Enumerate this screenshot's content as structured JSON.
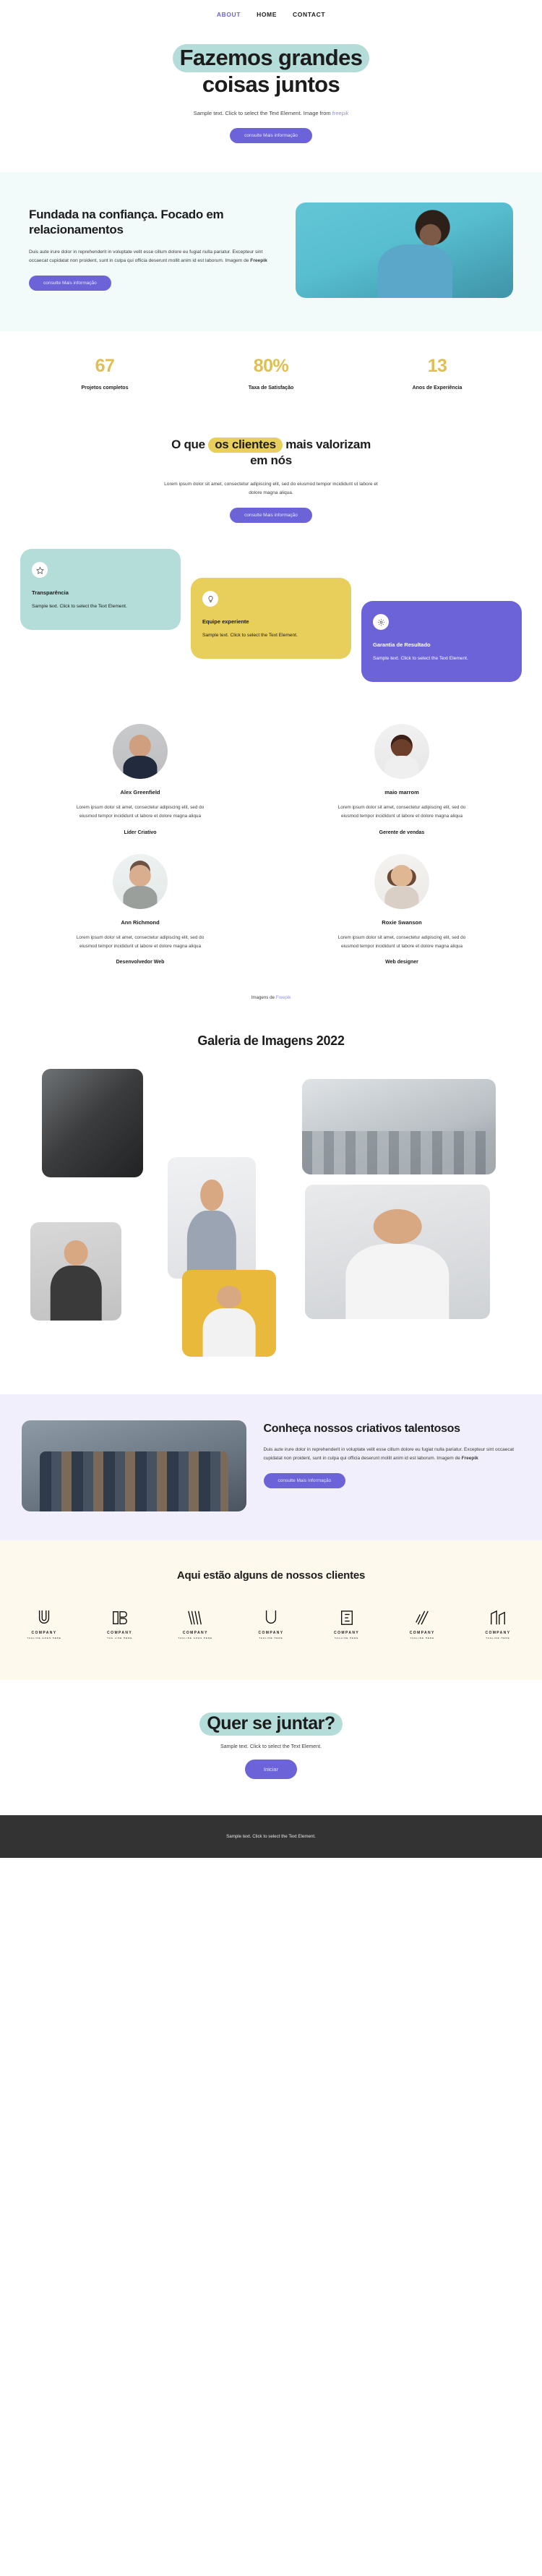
{
  "nav": {
    "items": [
      {
        "label": "ABOUT",
        "active": true
      },
      {
        "label": "HOME",
        "active": false
      },
      {
        "label": "CONTACT",
        "active": false
      }
    ]
  },
  "hero": {
    "title_line1": "Fazemos grandes",
    "title_line2": "coisas juntos",
    "subtitle_prefix": "Sample text. Click to select the Text Element. Image from ",
    "subtitle_link": "freepik",
    "cta": "consulte Mais informação"
  },
  "about": {
    "heading": "Fundada na confiança. Focado em relacionamentos",
    "body": "Duis aute irure dolor in reprehenderit in voluptate velit esse cillum dolore eu fugiat nulla pariatur. Excepteur sint occaecat cupidatat non proident, sunt in culpa qui officia deserunt mollit anim id est laborum. Imagem de ",
    "body_bold": "Freepik",
    "cta": "consulte Mais informação"
  },
  "stats": {
    "accent_color": "#ddbf52",
    "items": [
      {
        "number": "67",
        "label": "Projetos completos"
      },
      {
        "number": "80%",
        "label": "Taxa de Satisfação"
      },
      {
        "number": "13",
        "label": "Anos de Experiência"
      }
    ]
  },
  "values": {
    "heading_p1": "O que ",
    "heading_hl": "os clientes",
    "heading_p2": " mais valorizam em nós",
    "body": "Lorem ipsum dolor sit amet, consectetur adipiscing elit, sed do eiusmod tempor incididunt ut labore et dolore magna aliqua.",
    "cta": "consulte Mais informação"
  },
  "cards": [
    {
      "title": "Transparência",
      "text": "Sample text. Click to select the Text Element.",
      "icon": "star-icon",
      "color": "#b4dcd8"
    },
    {
      "title": "Equipe experiente",
      "text": "Sample text. Click to select the Text Element.",
      "icon": "lightbulb-icon",
      "color": "#e8ce5b"
    },
    {
      "title": "Garantia de Resultado",
      "text": "Sample text. Click to select the Text Element.",
      "icon": "gear-icon",
      "color": "#6c63d8"
    }
  ],
  "team": {
    "bio": "Lorem ipsum dolor sit amet, consectetur adipiscing elit, sed do eiusmod tempor incididunt ut labore et dolore magna aliqua",
    "members": [
      {
        "name": "Alex Greenfield",
        "role": "Líder Criativo"
      },
      {
        "name": "maio marrom",
        "role": "Gerente de vendas"
      },
      {
        "name": "Ann Richmond",
        "role": "Desenvolvedor Web"
      },
      {
        "name": "Roxie Swanson",
        "role": "Web designer"
      }
    ],
    "credit_prefix": "Imagens de ",
    "credit_link": "Freepik"
  },
  "gallery": {
    "heading": "Galeria de Imagens 2022"
  },
  "creative": {
    "heading": "Conheça nossos criativos talentosos",
    "body": "Duis aute irure dolor in reprehenderit in voluptate velit esse cillum dolore eu fugiat nulla pariatur. Excepteur sint occaecat cupidatat non proident, sunt in culpa qui officia deserunt mollit anim id est laborum. Imagem de ",
    "body_bold": "Freepik",
    "cta": "consulte Mais informação"
  },
  "clients": {
    "heading": "Aqui estão alguns de nossos clientes",
    "logos": [
      {
        "name": "COMPANY",
        "tagline": "TAGLINE GOES HERE"
      },
      {
        "name": "COMPANY",
        "tagline": "TAG LINE HERE"
      },
      {
        "name": "COMPANY",
        "tagline": "TAGLINE GOES HERE"
      },
      {
        "name": "COMPANY",
        "tagline": "TAGLINE HERE"
      },
      {
        "name": "COMPANY",
        "tagline": "TAGLINE HERE"
      },
      {
        "name": "COMPANY",
        "tagline": "TAGLINE HERE"
      },
      {
        "name": "COMPANY",
        "tagline": "TAGLINE HERE"
      }
    ]
  },
  "join": {
    "heading": "Quer se juntar?",
    "subtitle": "Sample text. Click to select the Text Element.",
    "cta": "Iniciar"
  },
  "footer": {
    "text": "Sample text. Click to select the Text Element."
  },
  "theme": {
    "mint": "#b4dcd8",
    "yellow": "#e8ce5b",
    "purple": "#6c63d8",
    "gold": "#ddbf52",
    "dark": "#333333"
  }
}
